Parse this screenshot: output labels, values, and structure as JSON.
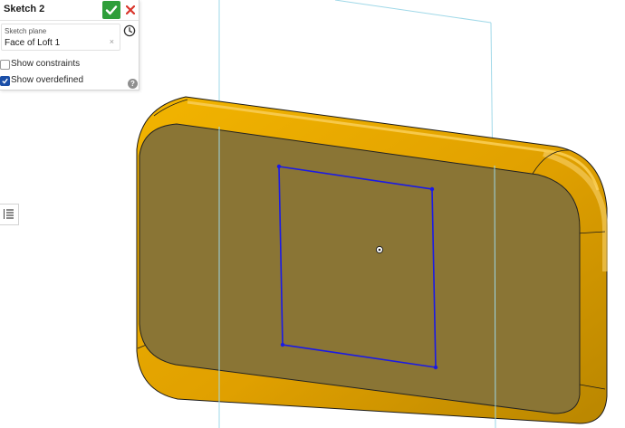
{
  "sketch_panel": {
    "title": "Sketch 2",
    "plane_label": "Sketch plane",
    "plane_value": "Face of Loft 1",
    "plane_clear": "×",
    "show_constraints": {
      "label": "Show constraints",
      "checked": false
    },
    "show_overdefined": {
      "label": "Show overdefined",
      "checked": true
    },
    "help": "?"
  },
  "icons": {
    "confirm": "check-icon",
    "close": "close-icon",
    "history": "clock-icon",
    "list": "list-icon"
  },
  "colors": {
    "body_orange": "#e8a400",
    "face": "#8a7535",
    "sketch_line": "#1a1ae6",
    "plane_line": "#9fd8e8",
    "confirm_green": "#2e9e3a",
    "close_red": "#d9352b"
  }
}
